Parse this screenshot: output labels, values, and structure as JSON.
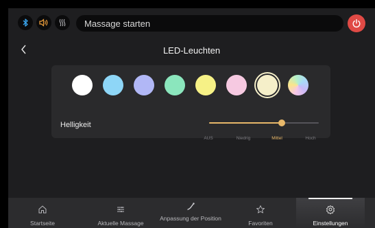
{
  "topbar": {
    "icons": [
      "bluetooth-icon",
      "volume-icon",
      "heat-icon"
    ],
    "search_text": "Massage starten",
    "power_icon": "power-icon"
  },
  "header": {
    "back_icon": "chevron-left-icon",
    "title": "LED-Leuchten"
  },
  "colors": {
    "swatches": [
      "#ffffff",
      "#8ed6f7",
      "#b1b7f6",
      "#8be6bd",
      "#f6f186",
      "#f6c9e1",
      "#f5efc9",
      "rainbow"
    ],
    "selected_index": 6,
    "accent": "#e8b86a",
    "power": "#e04a45"
  },
  "brightness": {
    "label": "Helligkeit",
    "levels": [
      "AUS",
      "Niedrig",
      "Mittel",
      "Hoch"
    ],
    "selected": "Mittel",
    "value_fraction": 0.66
  },
  "bottomnav": {
    "items": [
      {
        "label": "Startseite",
        "icon": "home-icon"
      },
      {
        "label": "Aktuelle Massage",
        "icon": "sliders-icon"
      },
      {
        "label": "Anpassung der Position",
        "icon": "recline-icon"
      },
      {
        "label": "Favoriten",
        "icon": "star-icon"
      },
      {
        "label": "Einstellungen",
        "icon": "gear-icon"
      }
    ],
    "active_index": 4
  }
}
